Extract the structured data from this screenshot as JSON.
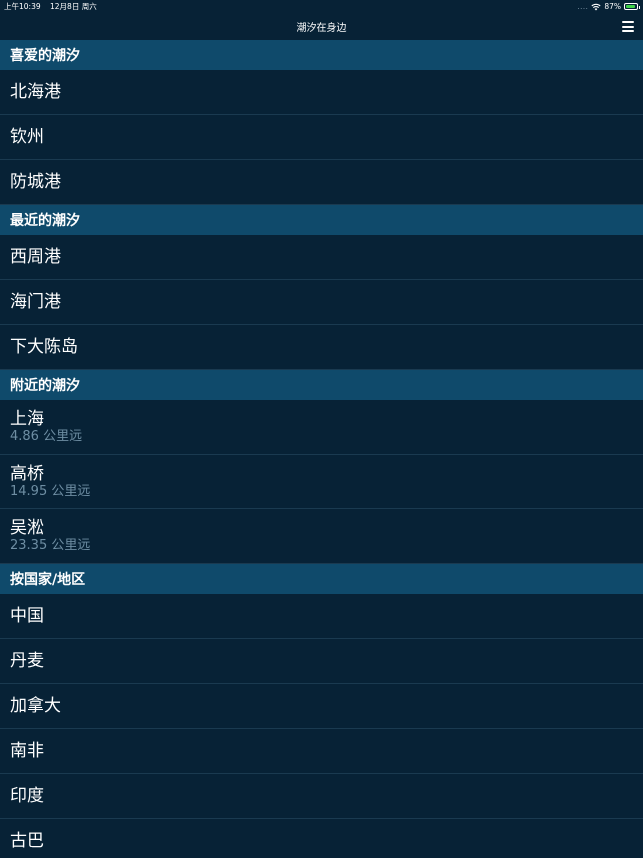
{
  "status": {
    "time": "上午10:39",
    "date": "12月8日 周六",
    "signal": "....",
    "battery_percent": "87%",
    "battery_level": 0.87
  },
  "nav": {
    "title": "潮汐在身边",
    "menu_icon": "hamburger-menu-icon"
  },
  "sections": [
    {
      "header": "喜爱的潮汐",
      "items": [
        {
          "title": "北海港"
        },
        {
          "title": "钦州"
        },
        {
          "title": "防城港"
        }
      ]
    },
    {
      "header": "最近的潮汐",
      "items": [
        {
          "title": "西周港"
        },
        {
          "title": "海门港"
        },
        {
          "title": "下大陈岛"
        }
      ]
    },
    {
      "header": "附近的潮汐",
      "items": [
        {
          "title": "上海",
          "subtitle": "4.86 公里远"
        },
        {
          "title": "高桥",
          "subtitle": "14.95 公里远"
        },
        {
          "title": "吴淞",
          "subtitle": "23.35 公里远"
        }
      ]
    },
    {
      "header": "按国家/地区",
      "items": [
        {
          "title": "中国"
        },
        {
          "title": "丹麦"
        },
        {
          "title": "加拿大"
        },
        {
          "title": "南非"
        },
        {
          "title": "印度"
        },
        {
          "title": "古巴"
        }
      ]
    }
  ],
  "colors": {
    "background": "#072236",
    "section_header": "#0f4a6b",
    "subtitle": "#6e8ea3",
    "battery": "#3fd34a"
  }
}
